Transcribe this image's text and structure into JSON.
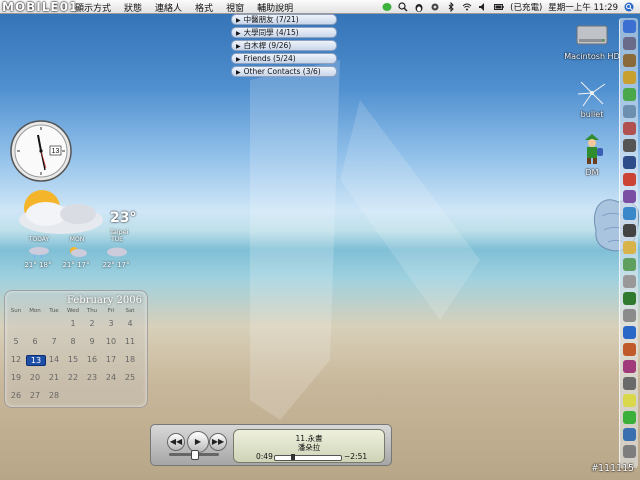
{
  "logo": {
    "text": "MOBILE01"
  },
  "menubar": {
    "items": [
      "顯示方式",
      "狀態",
      "連絡人",
      "格式",
      "視窗",
      "輔助說明"
    ],
    "battery_text": "(已充電)",
    "clock_text": "星期一上午 11:29"
  },
  "contact_groups": [
    {
      "label": "中醫朋友 (7/21)"
    },
    {
      "label": "大學同學 (4/15)"
    },
    {
      "label": "白木桿 (9/26)"
    },
    {
      "label": "Friends (5/24)"
    },
    {
      "label": "Other Contacts (3/6)"
    }
  ],
  "desktop_icons": {
    "hd": "Macintosh HD",
    "bullet": "bullet",
    "dm": "DM"
  },
  "clock_widget": {
    "date_box": "13"
  },
  "weather": {
    "temp": "23°",
    "city": "Taipei",
    "days": [
      "TODAY",
      "MON",
      "TUE"
    ],
    "temps": [
      "21° 18°",
      "21° 17°",
      "22° 17°"
    ]
  },
  "calendar": {
    "title": "February 2006",
    "dow": [
      "Sun",
      "Mon",
      "Tue",
      "Wed",
      "Thu",
      "Fri",
      "Sat"
    ],
    "weeks": [
      [
        "",
        "",
        "",
        "1",
        "2",
        "3",
        "4"
      ],
      [
        "5",
        "6",
        "7",
        "8",
        "9",
        "10",
        "11"
      ],
      [
        "12",
        "13",
        "14",
        "15",
        "16",
        "17",
        "18"
      ],
      [
        "19",
        "20",
        "21",
        "22",
        "23",
        "24",
        "25"
      ],
      [
        "26",
        "27",
        "28",
        "",
        "",
        "",
        ""
      ]
    ],
    "today": "13"
  },
  "player": {
    "song": "11.永晝",
    "artist": "潘朵拉",
    "elapsed": "0:49",
    "remaining": "−2:51",
    "progress": 0.25,
    "volume": 0.5
  },
  "footer_id": "#111115",
  "colors": {
    "accent": "#1e4fa8"
  }
}
